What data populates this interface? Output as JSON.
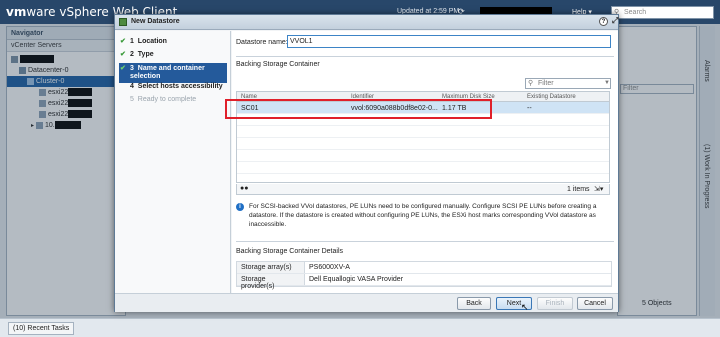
{
  "app": {
    "brand_vm": "vm",
    "brand_ware": "ware",
    "brand_product": " vSphere Web Client",
    "home_icon": "home-icon",
    "updated": "Updated at 2:59 PM",
    "help": "Help ▾",
    "search_placeholder": "Search"
  },
  "navigator": {
    "title": "Navigator",
    "vcenter": "vCenter Servers",
    "tree": [
      {
        "label": "Datacenter-0"
      },
      {
        "label": "Cluster-0"
      },
      {
        "label": "esxi22"
      },
      {
        "label": "esxi22"
      },
      {
        "label": "esxi22"
      },
      {
        "label": "10."
      }
    ]
  },
  "right_tabs": {
    "alarms": "Alarms",
    "work_in_progress": "(1) Work In Progress"
  },
  "background": {
    "filter_placeholder": "Filter",
    "objects_count": "5 Objects"
  },
  "bottom": {
    "recent_tasks": "(10) Recent Tasks"
  },
  "dialog": {
    "title": "New Datastore",
    "steps": [
      {
        "num": "1",
        "label": "Location",
        "state": "done"
      },
      {
        "num": "2",
        "label": "Type",
        "state": "done"
      },
      {
        "num": "3",
        "label": "Name and container selection",
        "state": "current"
      },
      {
        "num": "4",
        "label": "Select hosts accessibility",
        "state": "todo"
      },
      {
        "num": "5",
        "label": "Ready to complete",
        "state": "dim"
      }
    ],
    "datastore_name_label": "Datastore name:",
    "datastore_name_value": "VVOL1",
    "backing_container_label": "Backing Storage Container",
    "filter_placeholder": "Filter",
    "grid_headers": [
      "Name",
      "Identifier",
      "Maximum Disk Size",
      "Existing Datastore"
    ],
    "grid_rows": [
      {
        "name": "SC01",
        "identifier": "vvol:6090a088b0df8e02-0...",
        "max_size": "1.17 TB",
        "existing": "--"
      }
    ],
    "item_count": "1 items",
    "info_text": "For SCSI-backed VVol datastores, PE LUNs need to be configured manually. Configure SCSI PE LUNs before creating a datastore. If the datastore is created without configuring PE LUNs, the ESXi host marks corresponding VVol datastore as inaccessible.",
    "details_title": "Backing Storage Container Details",
    "details": [
      {
        "key": "Storage array(s)",
        "value": "PS6000XV-A"
      },
      {
        "key": "Storage provider(s)",
        "value": "Dell Equallogic VASA Provider"
      }
    ],
    "buttons": {
      "back": "Back",
      "next": "Next",
      "finish": "Finish",
      "cancel": "Cancel"
    }
  },
  "colors": {
    "topbar": "#28476a",
    "selection": "#1b5fa5",
    "highlight_box": "#e0202a"
  }
}
